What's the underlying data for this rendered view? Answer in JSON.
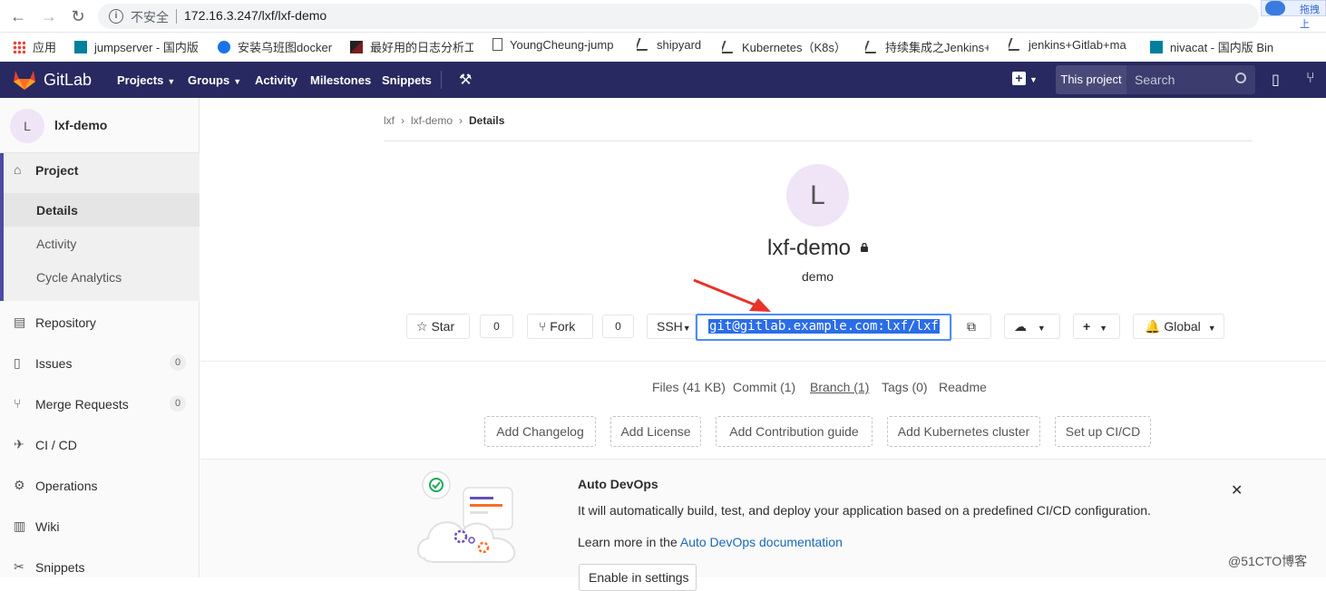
{
  "browser": {
    "insecure_label": "不安全",
    "url": "172.16.3.247/lxf/lxf-demo",
    "extension_label": "拖拽上"
  },
  "bookmarks": [
    {
      "label": "应用",
      "icon": "apps-grid-icon"
    },
    {
      "label": "jumpserver - 国内版",
      "icon": "bing-icon"
    },
    {
      "label": "安装乌班图docker",
      "icon": "bird-icon"
    },
    {
      "label": "最好用的日志分析工具",
      "icon": "v-logo-icon"
    },
    {
      "label": "YoungCheung-jump",
      "icon": "page-icon"
    },
    {
      "label": "shipyard",
      "icon": "s-logo-icon"
    },
    {
      "label": "Kubernetes（K8s）",
      "icon": "s-logo-icon"
    },
    {
      "label": "持续集成之Jenkins+",
      "icon": "s-logo-icon"
    },
    {
      "label": "jenkins+Gitlab+ma",
      "icon": "s-logo-icon"
    },
    {
      "label": "nivacat - 国内版 Bin",
      "icon": "bing-icon"
    }
  ],
  "header": {
    "brand": "GitLab",
    "nav": [
      "Projects",
      "Groups",
      "Activity",
      "Milestones",
      "Snippets"
    ],
    "scope_label": "This project",
    "search_placeholder": "Search"
  },
  "sidebar": {
    "avatar_letter": "L",
    "project_name": "lxf-demo",
    "project_label": "Project",
    "sub_items": [
      "Details",
      "Activity",
      "Cycle Analytics"
    ],
    "items": [
      {
        "label": "Repository",
        "icon": "book-icon"
      },
      {
        "label": "Issues",
        "icon": "issues-icon",
        "count": "0"
      },
      {
        "label": "Merge Requests",
        "icon": "merge-request-icon",
        "count": "0"
      },
      {
        "label": "CI / CD",
        "icon": "rocket-icon"
      },
      {
        "label": "Operations",
        "icon": "cloud-gear-icon"
      },
      {
        "label": "Wiki",
        "icon": "wiki-book-icon"
      },
      {
        "label": "Snippets",
        "icon": "snippet-icon"
      }
    ]
  },
  "breadcrumb": [
    "lxf",
    "lxf-demo",
    "Details"
  ],
  "project": {
    "avatar_letter": "L",
    "title": "lxf-demo",
    "description": "demo",
    "star_label": "Star",
    "star_count": "0",
    "fork_label": "Fork",
    "fork_count": "0",
    "protocol": "SSH",
    "clone_url": "git@gitlab.example.com:lxf/lxf",
    "notification_label": "Global"
  },
  "stats": {
    "files": "Files (41 KB)",
    "commit": "Commit (1)",
    "branch": "Branch (1)",
    "tags": "Tags (0)",
    "readme": "Readme"
  },
  "quick_actions": [
    "Add Changelog",
    "Add License",
    "Add Contribution guide",
    "Add Kubernetes cluster",
    "Set up CI/CD"
  ],
  "devops": {
    "title": "Auto DevOps",
    "text": "It will automatically build, test, and deploy your application based on a predefined CI/CD configuration.",
    "learn_prefix": "Learn more in the ",
    "learn_link": "Auto DevOps documentation",
    "enable_label": "Enable in settings"
  },
  "watermark": "@51CTO博客",
  "colors": {
    "header": "#292961",
    "accent": "#4b4ba3",
    "highlight": "#2b6de7",
    "arrow": "#e8322a"
  }
}
